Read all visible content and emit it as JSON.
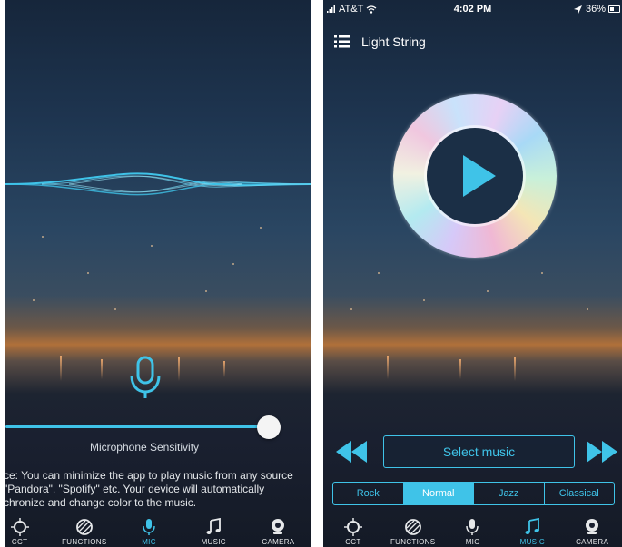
{
  "left_panel": {
    "sensitivity_label": "Microphone Sensitivity",
    "sensitivity_level": 0.9,
    "notice_lines": [
      "ce: You can minimize the app to play music from any source",
      " \"Pandora\", \"Spotify\" etc. Your device will automatically",
      "chronize and change color to the music."
    ],
    "tabs": [
      {
        "label": "CCT",
        "icon": "cct-icon",
        "active": false
      },
      {
        "label": "FUNCTIONS",
        "icon": "functions-icon",
        "active": false
      },
      {
        "label": "MIC",
        "icon": "mic-icon",
        "active": true
      },
      {
        "label": "MUSIC",
        "icon": "music-icon",
        "active": false
      },
      {
        "label": "CAMERA",
        "icon": "camera-icon",
        "active": false
      }
    ]
  },
  "right_panel": {
    "status": {
      "carrier": "AT&T",
      "time": "4:02 PM",
      "battery": "36%"
    },
    "title": "Light String",
    "select_music_label": "Select music",
    "genres": [
      {
        "label": "Rock",
        "active": false
      },
      {
        "label": "Normal",
        "active": true
      },
      {
        "label": "Jazz",
        "active": false
      },
      {
        "label": "Classical",
        "active": false
      }
    ],
    "tabs": [
      {
        "label": "CCT",
        "icon": "cct-icon",
        "active": false
      },
      {
        "label": "FUNCTIONS",
        "icon": "functions-icon",
        "active": false
      },
      {
        "label": "MIC",
        "icon": "mic-icon",
        "active": false
      },
      {
        "label": "MUSIC",
        "icon": "music-icon",
        "active": true
      },
      {
        "label": "CAMERA",
        "icon": "camera-icon",
        "active": false
      }
    ]
  },
  "colors": {
    "accent": "#3fc3e8"
  }
}
